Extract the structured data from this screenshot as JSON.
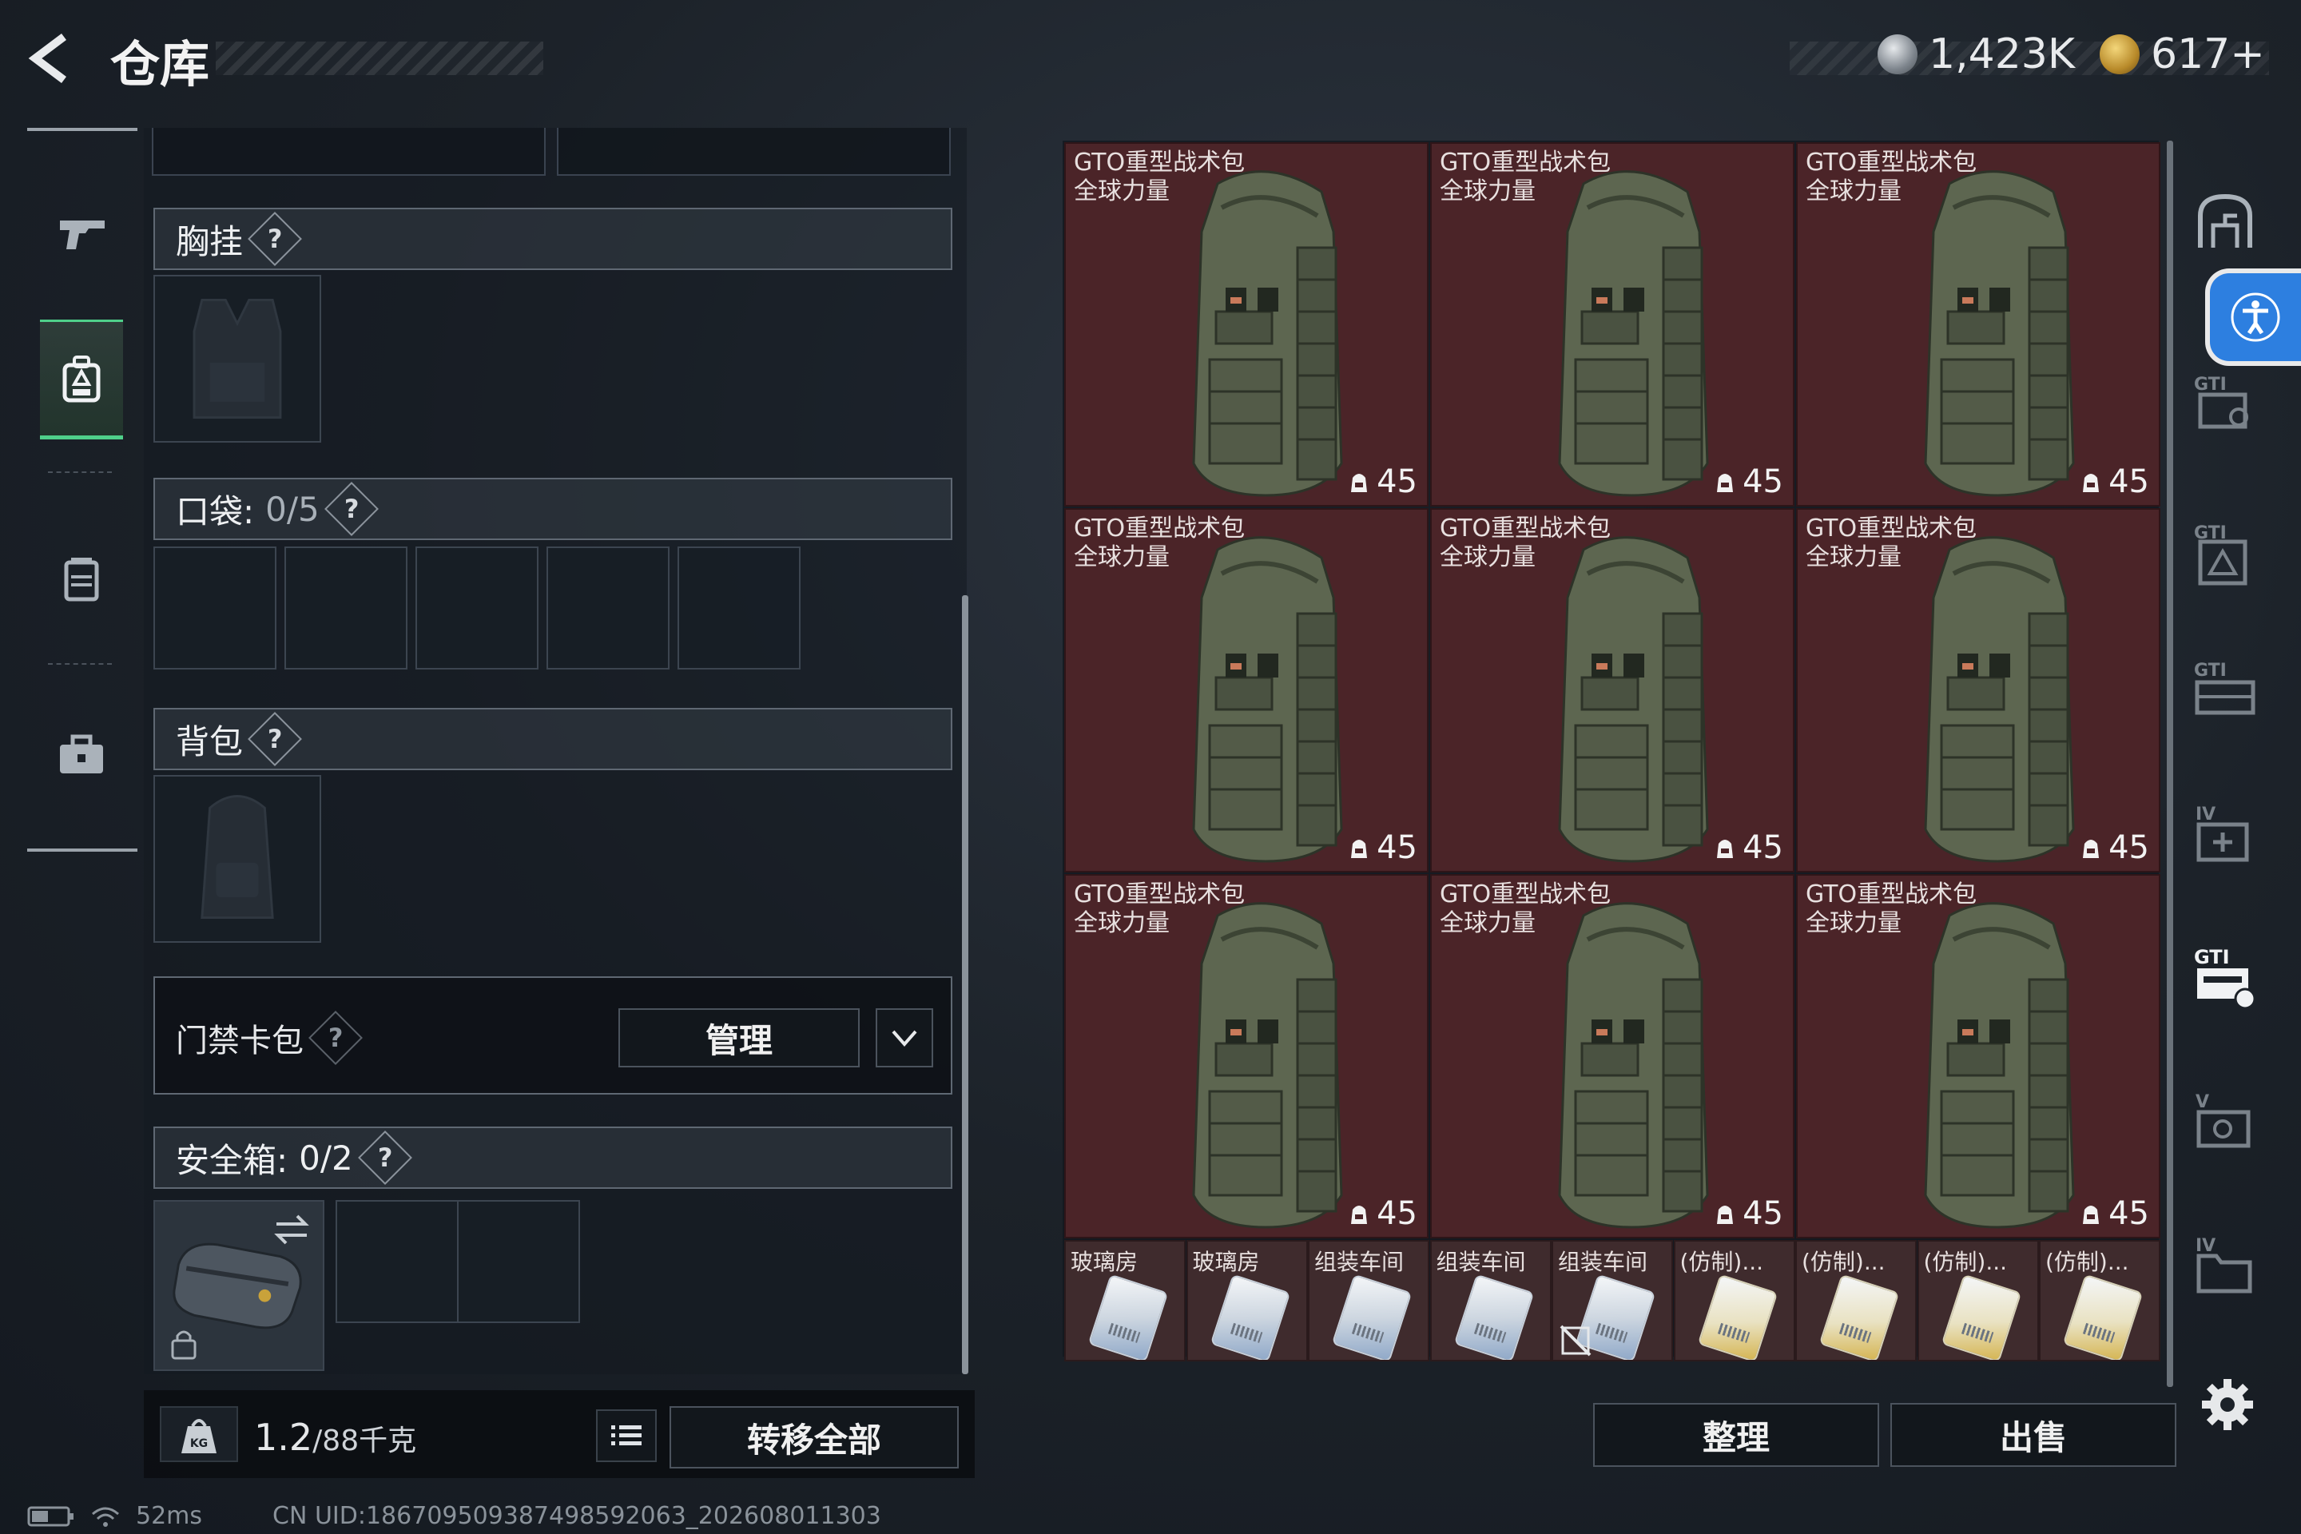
{
  "header": {
    "title": "仓库",
    "currency_silver": "1,423K",
    "currency_gold": "617+"
  },
  "equipment": {
    "chest_rig_label": "胸挂",
    "pockets_label": "口袋:",
    "pockets_count": "0/5",
    "backpack_label": "背包",
    "keycard_label": "门禁卡包",
    "manage_button": "管理",
    "safebox_label": "安全箱:",
    "safebox_count": "0/2",
    "help_mark": "?"
  },
  "weight": {
    "current": "1.2",
    "max": "/88千克",
    "transfer_all": "转移全部"
  },
  "status": {
    "ping": "52ms",
    "uid": "CN UID:1867095093874985920​63_202608011303"
  },
  "storage": {
    "big_items": [
      {
        "name_line1": "GTO重型战术包",
        "name_line2": "全球力量",
        "stack": "45"
      },
      {
        "name_line1": "GTO重型战术包",
        "name_line2": "全球力量",
        "stack": "45"
      },
      {
        "name_line1": "GTO重型战术包",
        "name_line2": "全球力量",
        "stack": "45"
      },
      {
        "name_line1": "GTO重型战术包",
        "name_line2": "全球力量",
        "stack": "45"
      },
      {
        "name_line1": "GTO重型战术包",
        "name_line2": "全球力量",
        "stack": "45"
      },
      {
        "name_line1": "GTO重型战术包",
        "name_line2": "全球力量",
        "stack": "45"
      },
      {
        "name_line1": "GTO重型战术包",
        "name_line2": "全球力量",
        "stack": "45"
      },
      {
        "name_line1": "GTO重型战术包",
        "name_line2": "全球力量",
        "stack": "45"
      },
      {
        "name_line1": "GTO重型战术包",
        "name_line2": "全球力量",
        "stack": "45"
      }
    ],
    "small_items": [
      {
        "name": "玻璃房",
        "card": "blue"
      },
      {
        "name": "玻璃房",
        "card": "blue"
      },
      {
        "name": "组装车间",
        "card": "blue"
      },
      {
        "name": "组装车间",
        "card": "blue"
      },
      {
        "name": "组装车间",
        "card": "blue"
      },
      {
        "name": "(仿制)...",
        "card": "yellow"
      },
      {
        "name": "(仿制)...",
        "card": "yellow"
      },
      {
        "name": "(仿制)...",
        "card": "yellow"
      },
      {
        "name": "(仿制)...",
        "card": "yellow"
      }
    ],
    "sort_button": "整理",
    "sell_button": "出售"
  },
  "colors": {
    "accent_green": "#4fd08a",
    "item_bg": "#4b2428",
    "access_blue": "#2d7fe0"
  }
}
